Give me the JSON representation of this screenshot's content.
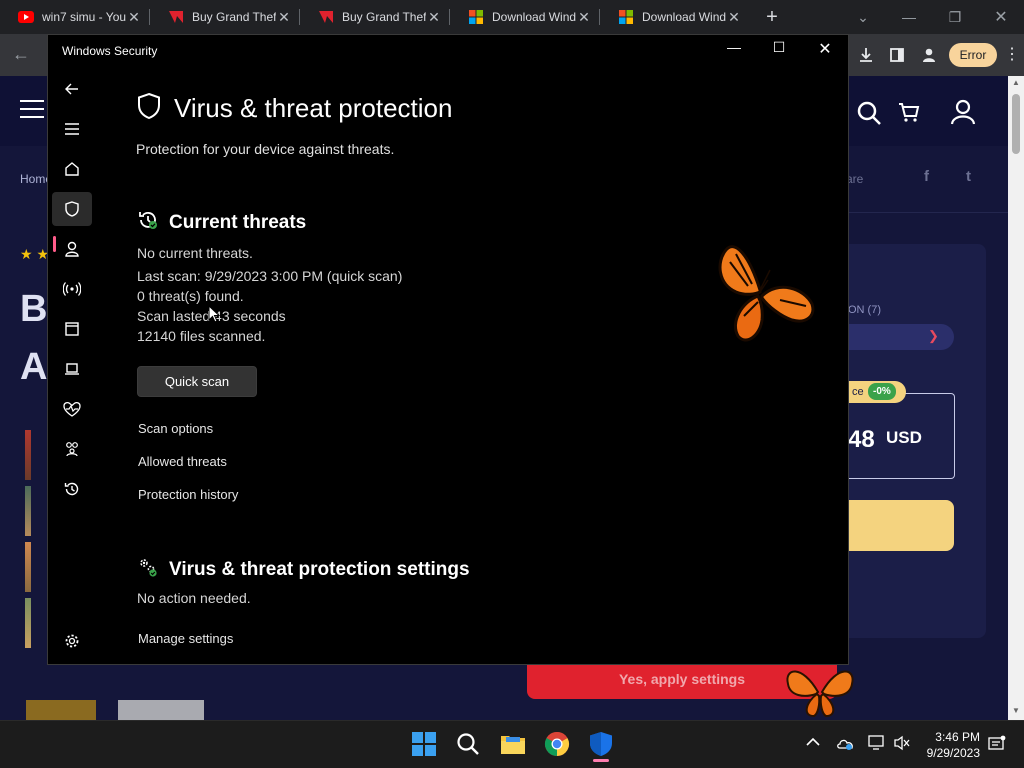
{
  "browser": {
    "tabs": [
      {
        "title": "win7 simu - You",
        "favicon": "youtube-icon"
      },
      {
        "title": "Buy Grand Thef",
        "favicon": "g2a-icon"
      },
      {
        "title": "Buy Grand Thef",
        "favicon": "g2a-icon"
      },
      {
        "title": "Download Wind",
        "favicon": "microsoft-icon"
      },
      {
        "title": "Download Wind",
        "favicon": "microsoft-icon"
      }
    ],
    "error_label": "Error"
  },
  "website": {
    "breadcrumb": "Home",
    "share_label": "are",
    "facebook_glyph": "f",
    "twitter_glyph": "t",
    "stars": "★ ★",
    "title_line1": "B",
    "title_line2": "A",
    "edition_label": "ON (7)",
    "price_label": "ce",
    "discount": "-0%",
    "price_value": "48",
    "price_currency": "USD",
    "apply_button": "Yes, apply settings"
  },
  "app": {
    "window_title": "Windows Security",
    "page_title": "Virus & threat protection",
    "page_subtitle": "Protection for your device against threats.",
    "current_threats": {
      "title": "Current threats",
      "lines": [
        "No current threats.",
        "Last scan: 9/29/2023 3:00 PM (quick scan)",
        "0 threat(s) found.",
        "Scan lasted 43 seconds",
        "12140 files scanned."
      ],
      "quick_scan_button": "Quick scan",
      "links": [
        "Scan options",
        "Allowed threats",
        "Protection history"
      ]
    },
    "settings": {
      "title": "Virus & threat protection settings",
      "status": "No action needed.",
      "link": "Manage settings"
    }
  },
  "taskbar": {
    "time": "3:46 PM",
    "date": "9/29/2023"
  },
  "colors": {
    "accent_pink": "#ff5c8a",
    "status_green": "#3aa24a",
    "site_bg": "#14163a",
    "buy_yellow": "#f4d37f",
    "apply_red": "#e0222e"
  }
}
